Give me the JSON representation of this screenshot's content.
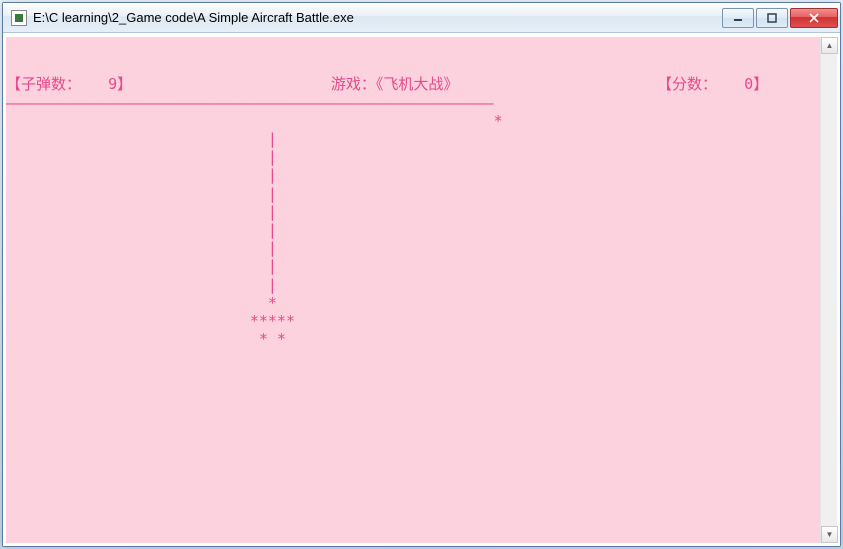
{
  "window": {
    "title": "E:\\C learning\\2_Game code\\A Simple Aircraft Battle.exe"
  },
  "game": {
    "header": {
      "bullets_label": "【子弹数：",
      "bullets_value": "9",
      "bullets_close": "】",
      "title": "游戏：《飞机大战》",
      "score_label": "【分数：",
      "score_value": "0",
      "score_close": "】"
    },
    "divider_char": "—",
    "enemy": {
      "glyph": "*",
      "col": 54
    },
    "bullets": {
      "glyph": "|",
      "col": 29,
      "rows": [
        3,
        4,
        5,
        6,
        7,
        8,
        9,
        10,
        11
      ]
    },
    "player": {
      "row1": "                             *",
      "row2": "                           *****",
      "row3": "                            * *"
    }
  },
  "colors": {
    "bg": "#fbd2de",
    "fg": "#e8498c"
  }
}
